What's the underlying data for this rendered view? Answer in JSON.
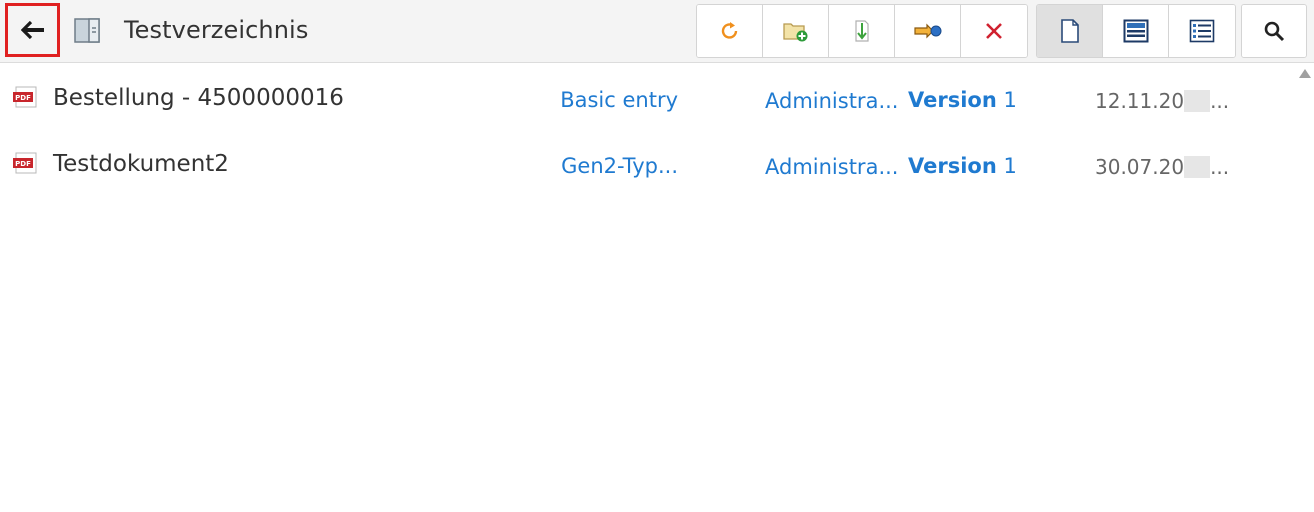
{
  "header": {
    "back_icon": "arrow-left-icon",
    "folder_icon": "folder-panel-icon",
    "title": "Testverzeichnis"
  },
  "toolbar": {
    "actions": [
      {
        "name": "refresh",
        "icon": "refresh-icon",
        "color": "#f0901e"
      },
      {
        "name": "new-folder",
        "icon": "folder-add-icon",
        "color": "#2e9b3a"
      },
      {
        "name": "download",
        "icon": "download-arrow-icon",
        "color": "#3ea33e"
      },
      {
        "name": "move",
        "icon": "move-hand-icon",
        "color": "#e8a020"
      },
      {
        "name": "delete",
        "icon": "close-x-icon",
        "color": "#d0212f"
      }
    ],
    "views": [
      {
        "name": "document-view",
        "icon": "document-icon",
        "active": true
      },
      {
        "name": "preview-view",
        "icon": "preview-list-icon",
        "active": false
      },
      {
        "name": "details-view",
        "icon": "detail-list-icon",
        "active": false
      }
    ],
    "search_icon": "search-icon"
  },
  "rows": [
    {
      "icon": "pdf-icon",
      "name": "Bestellung - 4500000016",
      "type": "Basic entry",
      "owner": "Administra...",
      "version_label": "Version",
      "version_number": "1",
      "date_prefix": "12.11.20",
      "date_suffix": "..."
    },
    {
      "icon": "pdf-icon",
      "name": "Testdokument2",
      "type": "Gen2-Typ...",
      "owner": "Administra...",
      "version_label": "Version",
      "version_number": "1",
      "date_prefix": "30.07.20",
      "date_suffix": "..."
    }
  ],
  "colors": {
    "accent_blue": "#1f7ad0",
    "highlight_red": "#e02020",
    "toolbar_bg": "#f4f4f4"
  }
}
